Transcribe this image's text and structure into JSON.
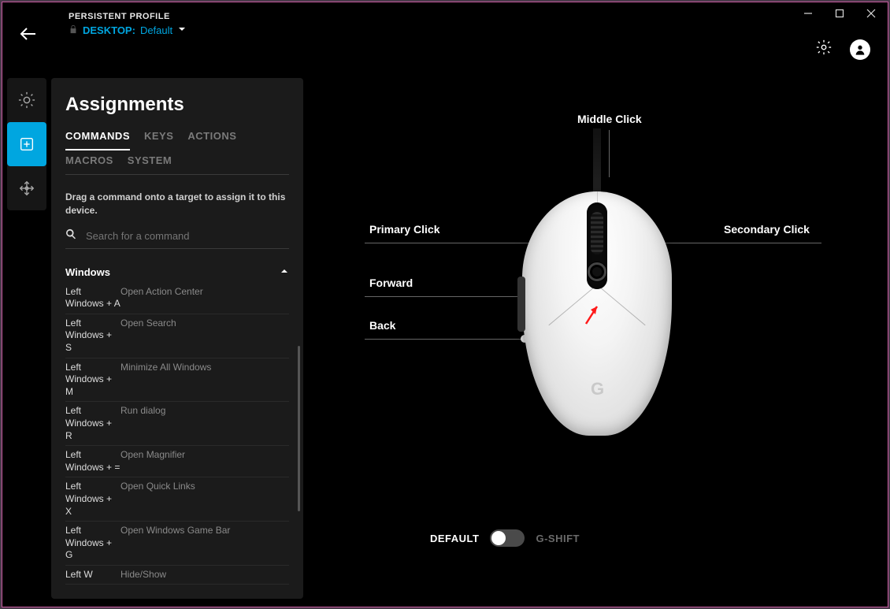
{
  "window": {
    "profile_label": "PERSISTENT PROFILE",
    "profile_target": "DESKTOP:",
    "profile_name": "Default"
  },
  "rail": {
    "items": [
      "lighting",
      "assignments",
      "sensitivity"
    ],
    "active_index": 1
  },
  "panel": {
    "title": "Assignments",
    "tabs": [
      "COMMANDS",
      "KEYS",
      "ACTIONS",
      "MACROS",
      "SYSTEM"
    ],
    "active_tab": 0,
    "hint": "Drag a command onto a target to assign it to this device.",
    "search_placeholder": "Search for a command",
    "group_title": "Windows",
    "commands": [
      {
        "key": "Left Windows + A",
        "desc": "Open Action Center"
      },
      {
        "key": "Left Windows + S",
        "desc": "Open Search"
      },
      {
        "key": "Left Windows + M",
        "desc": "Minimize All Windows"
      },
      {
        "key": "Left Windows + R",
        "desc": "Run dialog"
      },
      {
        "key": "Left Windows + =",
        "desc": "Open Magnifier"
      },
      {
        "key": "Left Windows + X",
        "desc": "Open Quick Links"
      },
      {
        "key": "Left Windows + G",
        "desc": "Open Windows Game Bar"
      },
      {
        "key": "Left W",
        "desc": "Hide/Show"
      }
    ]
  },
  "mouse_labels": {
    "middle": "Middle Click",
    "primary": "Primary Click",
    "secondary": "Secondary Click",
    "forward": "Forward",
    "back": "Back"
  },
  "modes": {
    "left": "DEFAULT",
    "right": "G-SHIFT",
    "on_left": true
  },
  "colors": {
    "accent": "#00a6e0"
  }
}
